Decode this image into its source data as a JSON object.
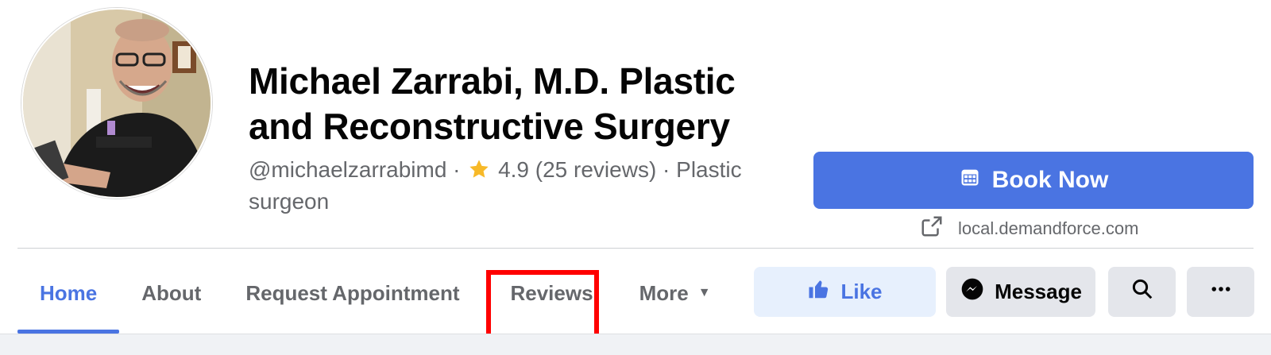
{
  "profile": {
    "name": "Michael Zarrabi, M.D. Plastic and Reconstructive Surgery",
    "handle": "@michaelzarrabimd",
    "separator": "·",
    "rating": "4.9",
    "reviews_text": "(25 reviews)",
    "category": "Plastic surgeon",
    "avatar_icon": "profile-photo",
    "star_icon": "star-icon",
    "star_color": "#f7b928"
  },
  "cta": {
    "book_label": "Book Now",
    "book_icon": "calendar-icon",
    "website": "local.demandforce.com",
    "website_icon": "external-link-icon",
    "color": "#4a74e2"
  },
  "tabs": [
    {
      "label": "Home",
      "active": true
    },
    {
      "label": "About",
      "active": false
    },
    {
      "label": "Request Appointment",
      "active": false
    },
    {
      "label": "Reviews",
      "active": false,
      "highlighted": true
    },
    {
      "label": "More",
      "active": false,
      "dropdown": true
    }
  ],
  "actions": {
    "like_label": "Like",
    "like_icon": "thumbs-up-icon",
    "message_label": "Message",
    "message_icon": "messenger-icon",
    "search_icon": "search-icon",
    "more_icon": "ellipsis-icon"
  },
  "highlight_color": "#ff0000"
}
